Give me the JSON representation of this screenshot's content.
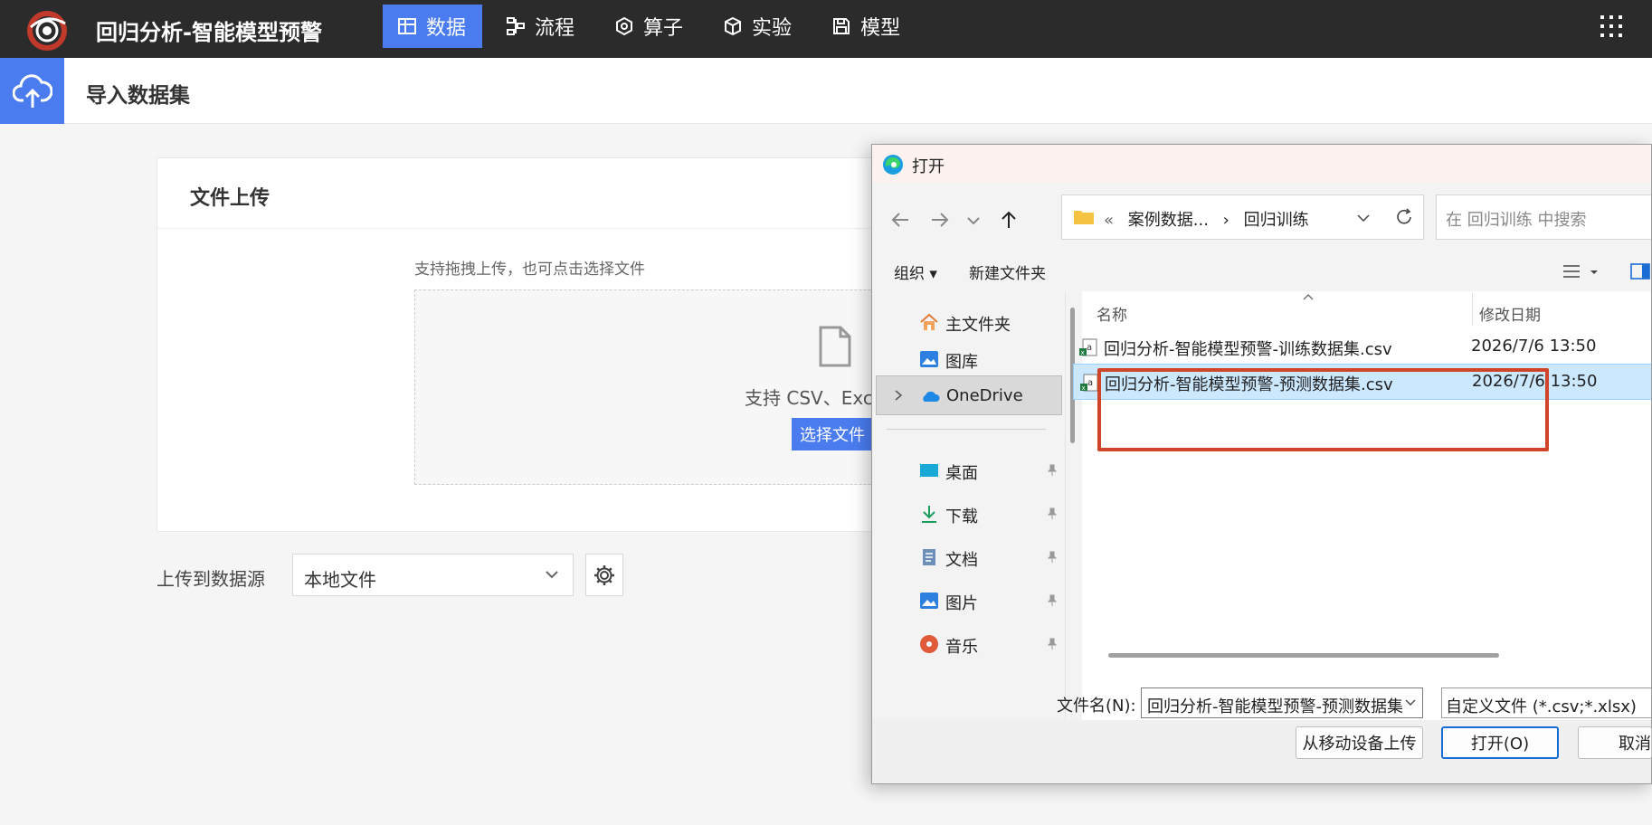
{
  "app": {
    "title": "回归分析-智能模型预警",
    "nav": [
      {
        "label": "数据",
        "icon": "table-icon",
        "active": true
      },
      {
        "label": "流程",
        "icon": "flow-icon",
        "active": false
      },
      {
        "label": "算子",
        "icon": "operator-icon",
        "active": false
      },
      {
        "label": "实验",
        "icon": "cube-icon",
        "active": false
      },
      {
        "label": "模型",
        "icon": "save-icon",
        "active": false
      }
    ],
    "accent_color": "#4a7cf0"
  },
  "page": {
    "title": "导入数据集"
  },
  "upload_card": {
    "title": "文件上传",
    "hint": "支持拖拽上传，也可点击选择文件",
    "support_text": "支持 CSV、Exce",
    "choose_button": "选择文件"
  },
  "source": {
    "label": "上传到数据源",
    "selected": "本地文件"
  },
  "dialog": {
    "title": "打开",
    "breadcrumb": [
      "«",
      "案例数据...",
      "›",
      "回归训练"
    ],
    "search_placeholder": "在 回归训练 中搜索",
    "toolbar": {
      "organize": "组织 ▾",
      "new_folder": "新建文件夹"
    },
    "nav_items": [
      {
        "label": "主文件夹",
        "icon": "home-icon",
        "pinned": false
      },
      {
        "label": "图库",
        "icon": "gallery-icon",
        "pinned": false
      },
      {
        "label": "OneDrive",
        "icon": "cloud-icon",
        "pinned": false,
        "selected": true
      },
      {
        "label": "桌面",
        "icon": "desktop-icon",
        "pinned": true
      },
      {
        "label": "下载",
        "icon": "download-icon",
        "pinned": true
      },
      {
        "label": "文档",
        "icon": "document-icon",
        "pinned": true
      },
      {
        "label": "图片",
        "icon": "picture-icon",
        "pinned": true
      },
      {
        "label": "音乐",
        "icon": "music-icon",
        "pinned": true
      }
    ],
    "columns": {
      "name": "名称",
      "modified": "修改日期"
    },
    "files": [
      {
        "name": "回归分析-智能模型预警-训练数据集.csv",
        "modified": "2026/7/6 13:50",
        "selected": false
      },
      {
        "name": "回归分析-智能模型预警-预测数据集.csv",
        "modified": "2026/7/6 13:50",
        "selected": true
      }
    ],
    "filename_label": "文件名(N):",
    "filename_value": "回归分析-智能模型预警-预测数据集",
    "filetype_value": "自定义文件 (*.csv;*.xlsx)",
    "buttons": {
      "mobile_upload": "从移动设备上传",
      "open": "打开(O)",
      "cancel": "取消"
    },
    "highlight_color": "#d0442a"
  }
}
